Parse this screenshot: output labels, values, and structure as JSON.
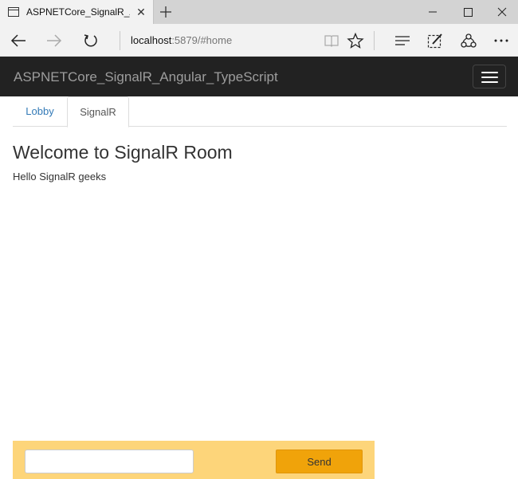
{
  "browser": {
    "tab_title": "ASPNETCore_SignalR_A",
    "tab_close": "✕",
    "address_host": "localhost",
    "address_rest": ":5879/#home"
  },
  "app": {
    "brand": "ASPNETCore_SignalR_Angular_TypeScript"
  },
  "tabs": [
    {
      "label": "Lobby",
      "active": false
    },
    {
      "label": "SignalR",
      "active": true
    }
  ],
  "main": {
    "title": "Welcome to SignalR Room",
    "messages": [
      "Hello SignalR geeks"
    ]
  },
  "composer": {
    "input_value": "",
    "input_placeholder": "",
    "send_label": "Send"
  },
  "colors": {
    "header_bg": "#222222",
    "brand_text": "#9d9d9d",
    "link": "#337ab7",
    "send_bar_bg": "#fdd57a",
    "send_button_bg": "#f0a30a"
  },
  "icons": {
    "tab": "tab-page-icon",
    "new_tab": "plus-icon",
    "back": "arrow-left-icon",
    "forward": "arrow-right-icon",
    "refresh": "refresh-icon",
    "reading_view": "book-icon",
    "favorite": "star-icon",
    "hub": "hub-lines-icon",
    "web_note": "pen-note-icon",
    "share": "share-icon",
    "more": "more-dots-icon",
    "menu": "hamburger-icon"
  }
}
